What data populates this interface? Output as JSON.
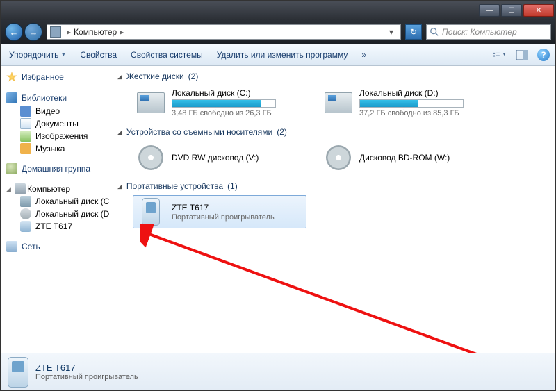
{
  "titlebar": {
    "min": "—",
    "max": "☐",
    "close": "✕"
  },
  "nav": {
    "back": "←",
    "fwd": "→"
  },
  "address": {
    "root_label": "Компьютер",
    "sep": "▸",
    "drop": "▾",
    "refresh": "↻"
  },
  "search": {
    "placeholder": "Поиск: Компьютер",
    "icon": "search"
  },
  "toolbar": {
    "organize": "Упорядочить",
    "properties": "Свойства",
    "sysprops": "Свойства системы",
    "uninstall": "Удалить или изменить программу",
    "more": "»",
    "view": "view",
    "preview": "preview",
    "help": "?"
  },
  "sidebar": {
    "favorites": "Избранное",
    "libraries": "Библиотеки",
    "lib_items": [
      "Видео",
      "Документы",
      "Изображения",
      "Музыка"
    ],
    "homegroup": "Домашняя группа",
    "computer": "Компьютер",
    "comp_items": [
      "Локальный диск (C",
      "Локальный диск (D",
      "ZTE T617"
    ],
    "network": "Сеть"
  },
  "groups": {
    "hdd": {
      "title": "Жесткие диски",
      "count": "(2)",
      "items": [
        {
          "label": "Локальный диск (C:)",
          "sub": "3,48 ГБ свободно из 26,3 ГБ",
          "fill": 86
        },
        {
          "label": "Локальный диск (D:)",
          "sub": "37,2 ГБ свободно из 85,3 ГБ",
          "fill": 56
        }
      ]
    },
    "removable": {
      "title": "Устройства со съемными носителями",
      "count": "(2)",
      "items": [
        {
          "label": "DVD RW дисковод (V:)",
          "sub": ""
        },
        {
          "label": "Дисковод BD-ROM (W:)",
          "sub": ""
        }
      ]
    },
    "portable": {
      "title": "Портативные устройства",
      "count": "(1)",
      "items": [
        {
          "label": "ZTE T617",
          "sub": "Портативный проигрыватель"
        }
      ]
    }
  },
  "details": {
    "name": "ZTE T617",
    "sub": "Портативный проигрыватель"
  }
}
